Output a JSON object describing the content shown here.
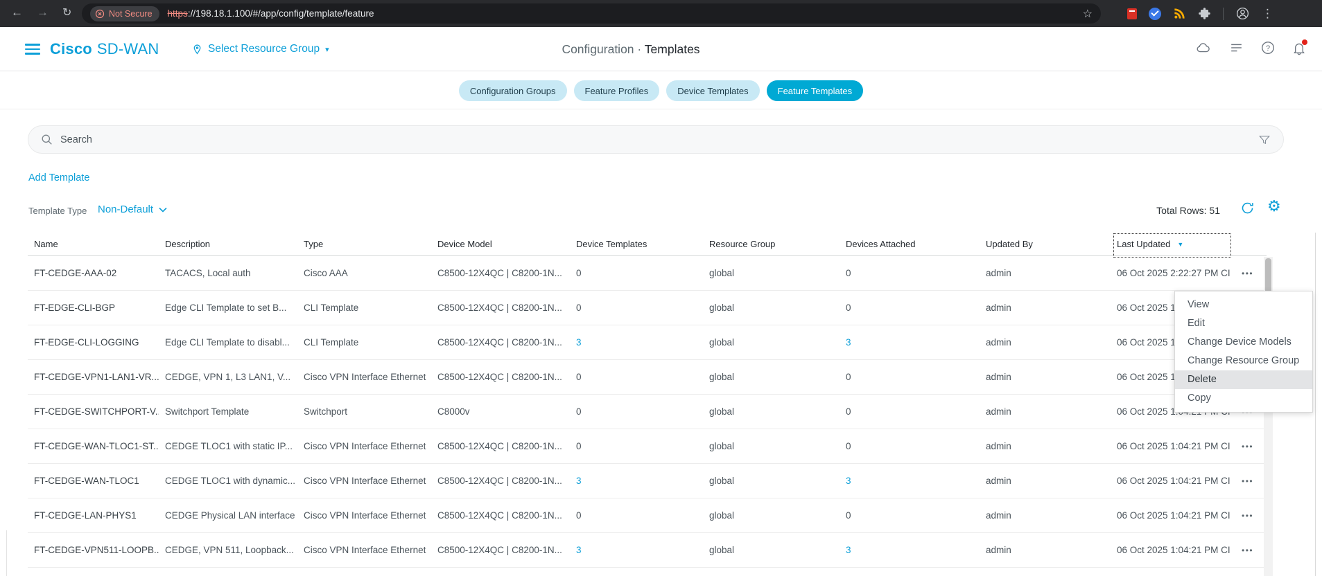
{
  "colors": {
    "accent": "#0d9fd8",
    "tab_active_bg": "#00a9d4",
    "tab_inactive_bg": "#c8e9f5",
    "link": "#0d9fd8",
    "insecure_badge": "#f28b82",
    "notification_dot": "#e2231a"
  },
  "browser": {
    "back_glyph": "←",
    "forward_glyph": "→",
    "reload_glyph": "↻",
    "security_badge": "Not Secure",
    "url_scheme": "https",
    "url_rest": "://198.18.1.100/#/app/config/template/feature",
    "star_glyph": "☆",
    "more_glyph": "⋮"
  },
  "header": {
    "brand_bold": "Cisco",
    "brand_light": "SD-WAN",
    "resource_group_label": "Select Resource Group",
    "resource_group_caret": "▾",
    "title_left": "Configuration",
    "title_sep": "·",
    "title_right": "Templates"
  },
  "tabs": [
    {
      "label": "Configuration Groups",
      "active": false
    },
    {
      "label": "Feature Profiles",
      "active": false
    },
    {
      "label": "Device Templates",
      "active": false
    },
    {
      "label": "Feature Templates",
      "active": true
    }
  ],
  "search": {
    "placeholder": "Search"
  },
  "actions": {
    "add_template": "Add Template"
  },
  "filter": {
    "label": "Template Type",
    "value": "Non-Default"
  },
  "summary": {
    "total_rows": "Total Rows: 51"
  },
  "toolbar_icons": {
    "gear_glyph": "⚙"
  },
  "table": {
    "columns": [
      "Name",
      "Description",
      "Type",
      "Device Model",
      "Device Templates",
      "Resource Group",
      "Devices Attached",
      "Updated By",
      "Last Updated"
    ],
    "sort_column": "Last Updated",
    "sort_glyph": "▼",
    "row_actions_glyph": "•••",
    "rows": [
      {
        "name": "FT-CEDGE-AAA-02",
        "description": "TACACS, Local auth",
        "type": "Cisco AAA",
        "device_model": "C8500-12X4QC | C8200-1N...",
        "device_templates": "0",
        "device_templates_link": false,
        "resource_group": "global",
        "devices_attached": "0",
        "devices_attached_link": false,
        "updated_by": "admin",
        "last_updated": "06 Oct 2025 2:22:27 PM CI"
      },
      {
        "name": "FT-EDGE-CLI-BGP",
        "description": "Edge CLI Template to set B...",
        "type": "CLI Template",
        "device_model": "C8500-12X4QC | C8200-1N...",
        "device_templates": "0",
        "device_templates_link": false,
        "resource_group": "global",
        "devices_attached": "0",
        "devices_attached_link": false,
        "updated_by": "admin",
        "last_updated": "06 Oct 2025 1:04:21 PM CI"
      },
      {
        "name": "FT-EDGE-CLI-LOGGING",
        "description": "Edge CLI Template to disabl...",
        "type": "CLI Template",
        "device_model": "C8500-12X4QC | C8200-1N...",
        "device_templates": "3",
        "device_templates_link": true,
        "resource_group": "global",
        "devices_attached": "3",
        "devices_attached_link": true,
        "updated_by": "admin",
        "last_updated": "06 Oct 2025 1:04:21 PM CI"
      },
      {
        "name": "FT-CEDGE-VPN1-LAN1-VR...",
        "description": "CEDGE, VPN 1, L3 LAN1, V...",
        "type": "Cisco VPN Interface Ethernet",
        "device_model": "C8500-12X4QC | C8200-1N...",
        "device_templates": "0",
        "device_templates_link": false,
        "resource_group": "global",
        "devices_attached": "0",
        "devices_attached_link": false,
        "updated_by": "admin",
        "last_updated": "06 Oct 2025 1:04:21 PM CI"
      },
      {
        "name": "FT-CEDGE-SWITCHPORT-V...",
        "description": "Switchport Template",
        "type": "Switchport",
        "device_model": "C8000v",
        "device_templates": "0",
        "device_templates_link": false,
        "resource_group": "global",
        "devices_attached": "0",
        "devices_attached_link": false,
        "updated_by": "admin",
        "last_updated": "06 Oct 2025 1:04:21 PM CI"
      },
      {
        "name": "FT-CEDGE-WAN-TLOC1-ST...",
        "description": "CEDGE TLOC1 with static IP...",
        "type": "Cisco VPN Interface Ethernet",
        "device_model": "C8500-12X4QC | C8200-1N...",
        "device_templates": "0",
        "device_templates_link": false,
        "resource_group": "global",
        "devices_attached": "0",
        "devices_attached_link": false,
        "updated_by": "admin",
        "last_updated": "06 Oct 2025 1:04:21 PM CI"
      },
      {
        "name": "FT-CEDGE-WAN-TLOC1",
        "description": "CEDGE TLOC1 with dynamic...",
        "type": "Cisco VPN Interface Ethernet",
        "device_model": "C8500-12X4QC | C8200-1N...",
        "device_templates": "3",
        "device_templates_link": true,
        "resource_group": "global",
        "devices_attached": "3",
        "devices_attached_link": true,
        "updated_by": "admin",
        "last_updated": "06 Oct 2025 1:04:21 PM CI"
      },
      {
        "name": "FT-CEDGE-LAN-PHYS1",
        "description": "CEDGE Physical LAN interface",
        "type": "Cisco VPN Interface Ethernet",
        "device_model": "C8500-12X4QC | C8200-1N...",
        "device_templates": "0",
        "device_templates_link": false,
        "resource_group": "global",
        "devices_attached": "0",
        "devices_attached_link": false,
        "updated_by": "admin",
        "last_updated": "06 Oct 2025 1:04:21 PM CI"
      },
      {
        "name": "FT-CEDGE-VPN511-LOOPB...",
        "description": "CEDGE, VPN 511, Loopback...",
        "type": "Cisco VPN Interface Ethernet",
        "device_model": "C8500-12X4QC | C8200-1N...",
        "device_templates": "3",
        "device_templates_link": true,
        "resource_group": "global",
        "devices_attached": "3",
        "devices_attached_link": true,
        "updated_by": "admin",
        "last_updated": "06 Oct 2025 1:04:21 PM CI"
      }
    ]
  },
  "context_menu": {
    "items": [
      {
        "label": "View",
        "highlighted": false
      },
      {
        "label": "Edit",
        "highlighted": false
      },
      {
        "label": "Change Device Models",
        "highlighted": false
      },
      {
        "label": "Change Resource Group",
        "highlighted": false
      },
      {
        "label": "Delete",
        "highlighted": true
      },
      {
        "label": "Copy",
        "highlighted": false
      }
    ]
  }
}
